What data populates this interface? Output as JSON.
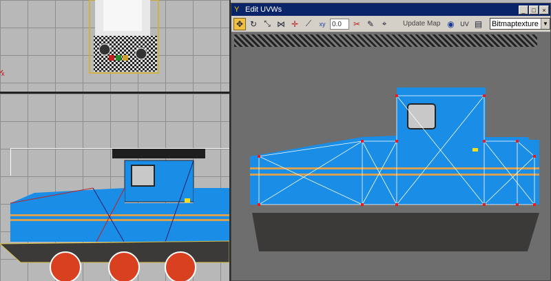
{
  "uvw_window": {
    "title": "Edit UVWs",
    "title_buttons": [
      "_",
      "□",
      "×"
    ],
    "toolbar": {
      "tools": [
        "move-icon",
        "rotate-icon",
        "scale-icon",
        "mirror-icon",
        "freeform-icon",
        "pan-icon",
        "xy-icon"
      ],
      "spinner_value": "0.0",
      "update_map_label": "Update Map",
      "uv_label": "UV",
      "texture_select_value": "Bitmaptexture"
    }
  },
  "colors": {
    "viewport_bg": "#b8b8b8",
    "uv_canvas_bg": "#6e6e6e",
    "train_blue": "#1a8ee6",
    "stripe": "#d8a050",
    "vertex": "#e81c1c"
  }
}
